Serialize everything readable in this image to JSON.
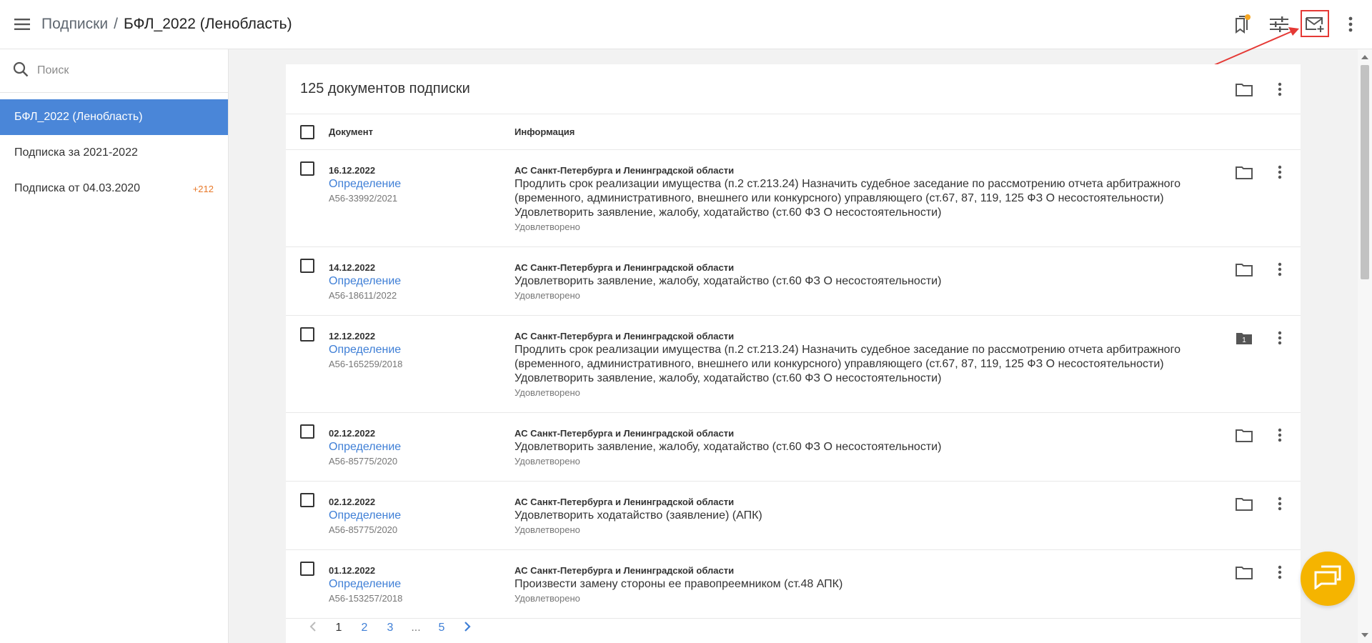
{
  "header": {
    "breadcrumb_root": "Подписки",
    "breadcrumb_sep": "/",
    "breadcrumb_current": "БФЛ_2022 (Ленобласть)",
    "icons": [
      "menu-icon",
      "bookmarks-icon",
      "filter-settings-icon",
      "mail-add-icon",
      "more-vert-icon"
    ],
    "notification_color": "#f5a623"
  },
  "sidebar": {
    "search_placeholder": "Поиск",
    "items": [
      {
        "label": "БФЛ_2022 (Ленобласть)",
        "count": "",
        "active": true
      },
      {
        "label": "Подписка за 2021-2022",
        "count": ""
      },
      {
        "label": "Подписка от 04.03.2020",
        "count": "+212"
      }
    ]
  },
  "main": {
    "title": "125 документов подписки",
    "columns": {
      "document": "Документ",
      "info": "Информация"
    },
    "rows": [
      {
        "date": "16.12.2022",
        "type": "Определение",
        "number": "А56-33992/2021",
        "court": "АС Санкт-Петербурга и Ленинградской области",
        "lines": [
          "Продлить срок реализации имущества (п.2 ст.213.24) Назначить судебное заседание по рассмотрению отчета арбитражного",
          "(временного, административного, внешнего или конкурсного) управляющего (ст.67, 87, 119, 125 ФЗ О несостоятельности)",
          "Удовлетворить заявление, жалобу, ходатайство (ст.60 ФЗ О несостоятельности)"
        ],
        "status": "Удовлетворено",
        "folder_count": ""
      },
      {
        "date": "14.12.2022",
        "type": "Определение",
        "number": "А56-18611/2022",
        "court": "АС Санкт-Петербурга и Ленинградской области",
        "lines": [
          "Удовлетворить заявление, жалобу, ходатайство (ст.60 ФЗ О несостоятельности)"
        ],
        "status": "Удовлетворено",
        "folder_count": ""
      },
      {
        "date": "12.12.2022",
        "type": "Определение",
        "number": "А56-165259/2018",
        "court": "АС Санкт-Петербурга и Ленинградской области",
        "lines": [
          "Продлить срок реализации имущества (п.2 ст.213.24) Назначить судебное заседание по рассмотрению отчета арбитражного",
          "(временного, административного, внешнего или конкурсного) управляющего (ст.67, 87, 119, 125 ФЗ О несостоятельности)",
          "Удовлетворить заявление, жалобу, ходатайство (ст.60 ФЗ О несостоятельности)"
        ],
        "status": "Удовлетворено",
        "folder_count": "1"
      },
      {
        "date": "02.12.2022",
        "type": "Определение",
        "number": "А56-85775/2020",
        "court": "АС Санкт-Петербурга и Ленинградской области",
        "lines": [
          "Удовлетворить заявление, жалобу, ходатайство (ст.60 ФЗ О несостоятельности)"
        ],
        "status": "Удовлетворено",
        "folder_count": ""
      },
      {
        "date": "02.12.2022",
        "type": "Определение",
        "number": "А56-85775/2020",
        "court": "АС Санкт-Петербурга и Ленинградской области",
        "lines": [
          "Удовлетворить ходатайство (заявление) (АПК)"
        ],
        "status": "Удовлетворено",
        "folder_count": ""
      },
      {
        "date": "01.12.2022",
        "type": "Определение",
        "number": "А56-153257/2018",
        "court": "АС Санкт-Петербурга и Ленинградской области",
        "lines": [
          "Произвести замену стороны ее правопреемником (ст.48 АПК)"
        ],
        "status": "Удовлетворено",
        "folder_count": ""
      }
    ]
  },
  "pagination": {
    "pages": [
      "1",
      "2",
      "3",
      "...",
      "5"
    ],
    "current": "1"
  },
  "colors": {
    "accent": "#4a86d8",
    "link": "#3f7fd6",
    "count": "#e8792a",
    "fab": "#f5b400",
    "annotation": "#e53935"
  }
}
